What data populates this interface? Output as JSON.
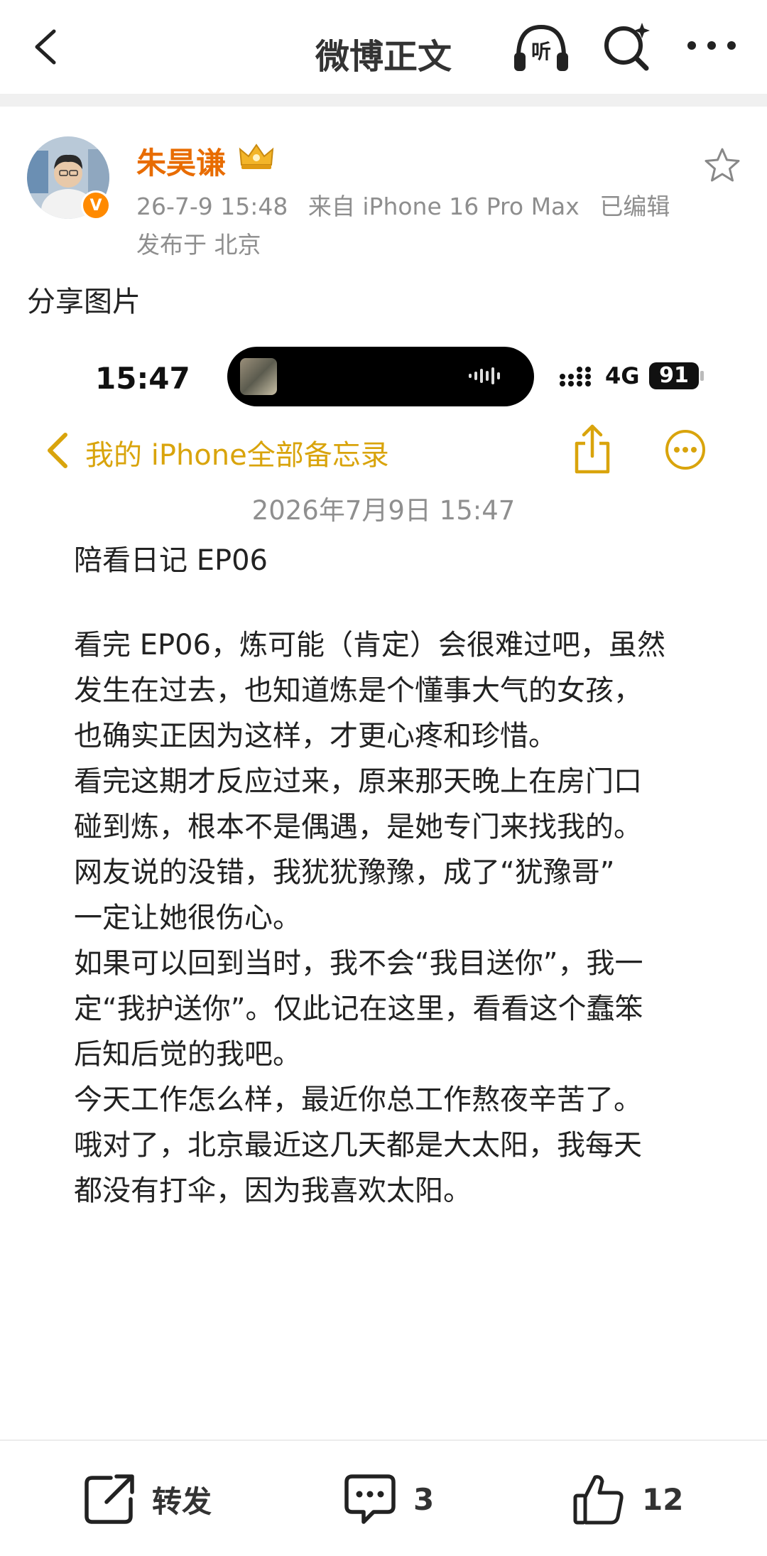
{
  "nav": {
    "title": "微博正文",
    "listen_label": "听",
    "icons": [
      "back-arrow-icon",
      "listen-headphone-icon",
      "search-sparkle-icon",
      "more-dots-icon"
    ]
  },
  "author": {
    "name": "朱昊谦",
    "verified_badge": "V",
    "timestamp": "26-7-9 15:48",
    "source": "来自 iPhone 16 Pro Max",
    "edited": "已编辑",
    "location": "发布于 北京"
  },
  "post": {
    "text": "分享图片"
  },
  "embedded_screenshot": {
    "status_bar": {
      "time": "15:47",
      "network": "4G",
      "battery": "91"
    },
    "notes": {
      "folder": "我的 iPhone全部备忘录",
      "date": "2026年7月9日 15:47",
      "title": "陪看日记 EP06",
      "lines": [
        "看完 EP06，炼可能（肯定）会很难过吧，虽然",
        "发生在过去，也知道炼是个懂事大气的女孩，",
        "也确实正因为这样，才更心疼和珍惜。",
        "看完这期才反应过来，原来那天晚上在房门口",
        "碰到炼，根本不是偶遇，是她专门来找我的。",
        "网友说的没错，我犹犹豫豫，成了“犹豫哥”",
        "一定让她很伤心。",
        "如果可以回到当时，我不会“我目送你”，我一",
        "定“我护送你”。仅此记在这里，看看这个蠢笨",
        "后知后觉的我吧。",
        "今天工作怎么样，最近你总工作熬夜辛苦了。",
        "哦对了，北京最近这几天都是大太阳，我每天",
        "都没有打伞，因为我喜欢太阳。"
      ]
    }
  },
  "actions": {
    "repost_label": "转发",
    "comment_count": "3",
    "like_count": "12"
  },
  "colors": {
    "author_orange": "#e86c00",
    "notes_yellow": "#d9a40c",
    "verify_orange": "#ff8a00"
  }
}
